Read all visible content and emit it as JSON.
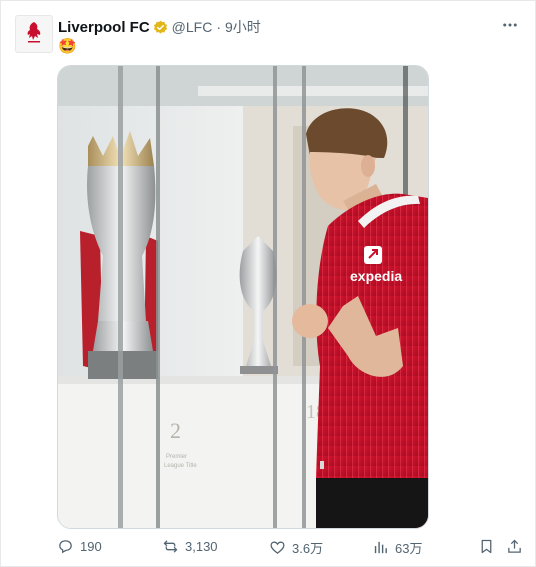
{
  "tweet": {
    "author_name": "Liverpool FC",
    "handle": "@LFC",
    "separator": "·",
    "time": "9小时",
    "text_emoji": "🤩",
    "avatar_text": "LFC",
    "accent": "#1d9bf0",
    "verified_color": "#e2b719"
  },
  "media": {
    "shirt_sponsor": "expedia",
    "cabinet_number": "2",
    "cabinet_caption_1": "Premier",
    "cabinet_caption_2": "League Title",
    "cabinet_number_right": "18",
    "shirt_color": "#c8102e"
  },
  "actions": {
    "replies": "190",
    "reposts": "3,130",
    "likes": "3.6万",
    "views": "63万"
  }
}
